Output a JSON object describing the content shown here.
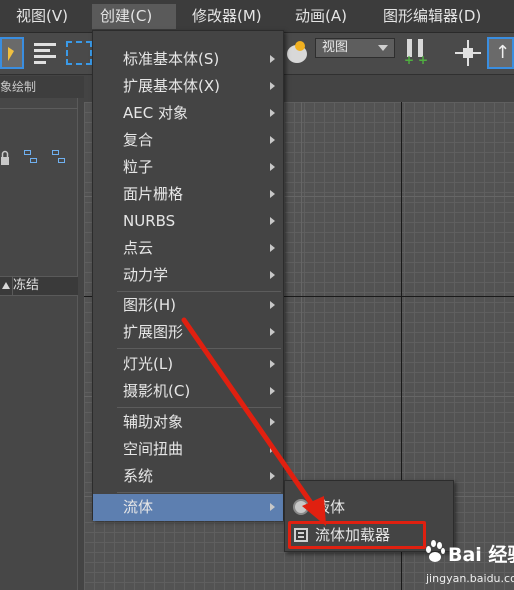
{
  "menubar": {
    "items": [
      {
        "label": "视图(V)"
      },
      {
        "label": "创建(C)"
      },
      {
        "label": "修改器(M)"
      },
      {
        "label": "动画(A)"
      },
      {
        "label": "图形编辑器(D)"
      }
    ]
  },
  "toolbar": {
    "view_dropdown_value": "视图"
  },
  "left_panel": {
    "subbar_text": "象绘制",
    "column_header": "冻结"
  },
  "create_menu": {
    "items": [
      {
        "label": "标准基本体(S)",
        "submenu": true
      },
      {
        "label": "扩展基本体(X)",
        "submenu": true
      },
      {
        "label": "AEC 对象",
        "submenu": true
      },
      {
        "label": "复合",
        "submenu": true
      },
      {
        "label": "粒子",
        "submenu": true
      },
      {
        "label": "面片栅格",
        "submenu": true
      },
      {
        "label": "NURBS",
        "submenu": true
      },
      {
        "label": "点云",
        "submenu": true
      },
      {
        "label": "动力学",
        "submenu": true
      },
      {
        "label": "图形(H)",
        "submenu": true
      },
      {
        "label": "扩展图形",
        "submenu": true
      },
      {
        "label": "灯光(L)",
        "submenu": true
      },
      {
        "label": "摄影机(C)",
        "submenu": true
      },
      {
        "label": "辅助对象",
        "submenu": true
      },
      {
        "label": "空间扭曲",
        "submenu": true
      },
      {
        "label": "系统",
        "submenu": true
      },
      {
        "label": "流体",
        "submenu": true,
        "highlighted": true
      }
    ]
  },
  "fluid_submenu": {
    "items": [
      {
        "label": "液体",
        "icon": "liquid-icon"
      },
      {
        "label": "流体加载器",
        "icon": "list-icon"
      }
    ]
  },
  "watermark": {
    "brand": "Bai 经验",
    "url": "jingyan.baidu.com"
  },
  "colors": {
    "highlight": "#5d7fb0",
    "annotation_red": "#e02010",
    "accent_blue": "#3a8ee0"
  }
}
